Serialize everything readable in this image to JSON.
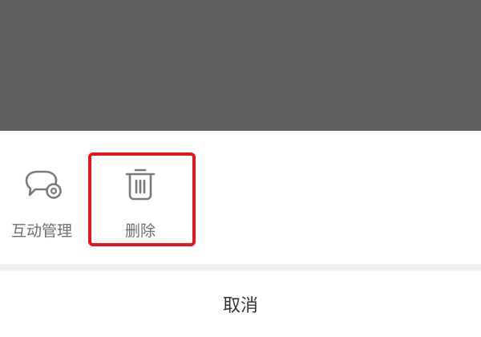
{
  "sheet": {
    "actions": [
      {
        "label": "互动管理",
        "icon": "chat-settings-icon"
      },
      {
        "label": "删除",
        "icon": "trash-icon"
      }
    ],
    "cancel_label": "取消"
  },
  "colors": {
    "overlay": "#5f5f5f",
    "highlight": "#e4181c",
    "icon": "#7a7a7a",
    "label": "#6f6f6f"
  }
}
